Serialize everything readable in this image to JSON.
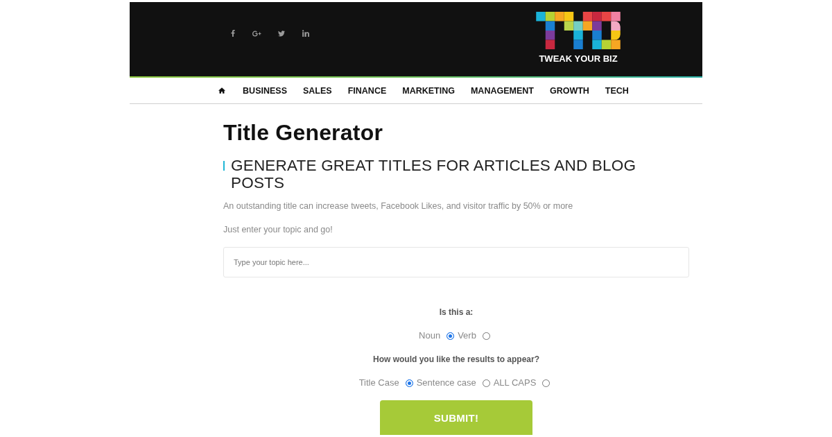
{
  "header": {
    "logo_text": "TWEAK YOUR BIZ"
  },
  "nav": {
    "items": [
      "BUSINESS",
      "SALES",
      "FINANCE",
      "MARKETING",
      "MANAGEMENT",
      "GROWTH",
      "TECH"
    ]
  },
  "form": {
    "title": "Title Generator",
    "subtitle": "GENERATE GREAT TITLES FOR ARTICLES AND BLOG POSTS",
    "paragraphs": [
      "An outstanding title can increase tweets, Facebook Likes, and visitor traffic by 50% or more",
      "Just enter your topic and go!"
    ],
    "topic_field": {
      "placeholder": "Type your topic here..."
    },
    "questions": [
      {
        "label": "Is this a:",
        "options": [
          {
            "label": "Noun",
            "selected": true
          },
          {
            "label": "Verb",
            "selected": false
          }
        ]
      },
      {
        "label": "How would you like the results to appear?",
        "options": [
          {
            "label": "Title Case",
            "selected": true
          },
          {
            "label": "Sentence case",
            "selected": false
          },
          {
            "label": "ALL CAPS",
            "selected": false
          }
        ]
      }
    ],
    "submit_button": "SUBMIT!"
  }
}
